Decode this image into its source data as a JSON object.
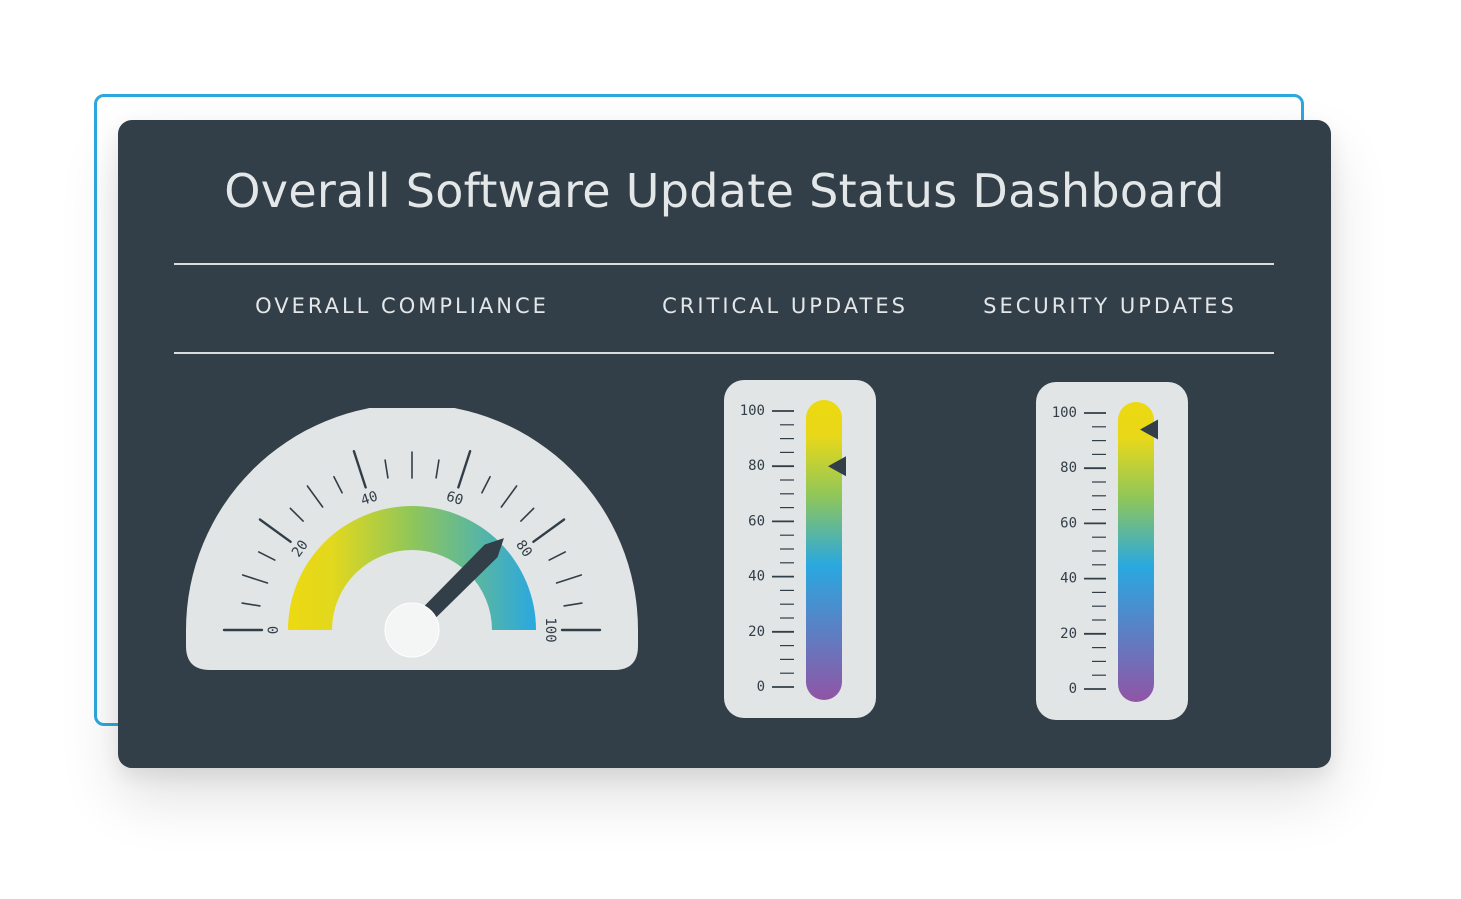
{
  "title": "Overall Software Update Status Dashboard",
  "sections": {
    "compliance_label": "OVERALL COMPLIANCE",
    "critical_label": "CRITICAL UPDATES",
    "security_label": "SECURITY UPDATES"
  },
  "colors": {
    "card_bg": "#323e48",
    "panel_bg": "#e2e5e5",
    "accent_frame": "#2ea7df",
    "gradient_low": "#ecd911",
    "gradient_mid_green": "#8fc65a",
    "gradient_mid_blue": "#2aa8e0",
    "gradient_high": "#9055a6"
  },
  "chart_data": [
    {
      "type": "gauge",
      "name": "OVERALL COMPLIANCE",
      "value": 75,
      "range": [
        0,
        100
      ],
      "tick_labels": [
        "0",
        "20",
        "40",
        "60",
        "80",
        "100"
      ],
      "colored_band": [
        0,
        100
      ]
    },
    {
      "type": "thermometer",
      "name": "CRITICAL UPDATES",
      "value": 80,
      "range": [
        0,
        100
      ],
      "tick_labels": [
        "0",
        "20",
        "40",
        "60",
        "80",
        "100"
      ]
    },
    {
      "type": "thermometer",
      "name": "SECURITY UPDATES",
      "value": 94,
      "range": [
        0,
        100
      ],
      "tick_labels": [
        "0",
        "20",
        "40",
        "60",
        "80",
        "100"
      ]
    }
  ]
}
